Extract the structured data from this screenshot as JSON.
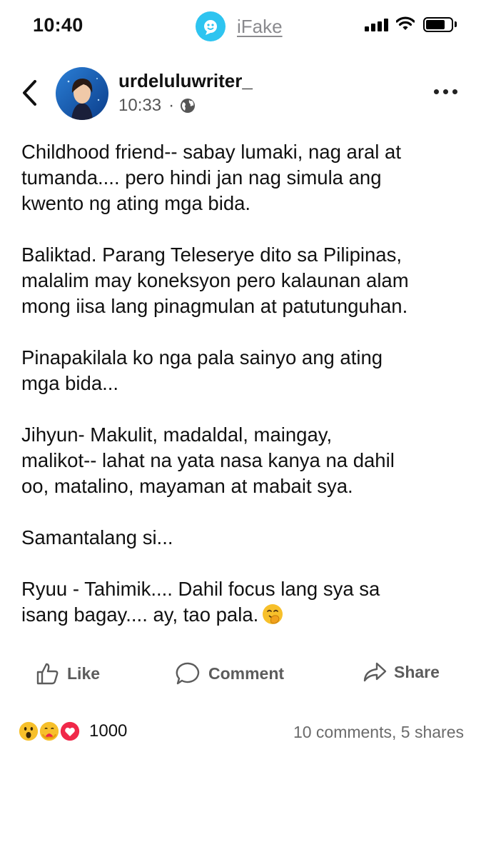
{
  "status_bar": {
    "time": "10:40",
    "carrier": "iFake",
    "battery_level": 0.75,
    "signal_bars": 4
  },
  "post": {
    "author": "urdeluluwriter_",
    "time": "10:33",
    "dot": "·",
    "privacy_icon": "globe-icon",
    "paragraphs": [
      "Childhood friend-- sabay lumaki, nag aral at\ntumanda.... pero hindi jan nag simula ang\nkwento ng ating mga bida.",
      "Baliktad. Parang Teleserye dito sa Pilipinas,\nmalalim may koneksyon pero kalaunan alam\nmong iisa lang pinagmulan at patutunguhan.",
      "Pinapakilala ko nga pala sainyo ang ating\nmga bida...",
      "Jihyun- Makulit, madaldal, maingay,\nmalikot-- lahat na yata nasa kanya na dahil\noo, matalino, mayaman at mabait sya.",
      "Samantalang si...",
      "Ryuu - Tahimik.... Dahil focus lang sya sa\nisang bagay.... ay, tao pala."
    ]
  },
  "actions": {
    "like": "Like",
    "comment": "Comment",
    "share": "Share"
  },
  "reactions": {
    "icons": [
      "wow-icon",
      "care-icon",
      "love-icon"
    ],
    "count": "1000",
    "stats": "10 comments, 5 shares"
  },
  "colors": {
    "carrier_logo": "#2ec4f0",
    "muted_text": "#5c5c5c",
    "love": "#f02849"
  }
}
